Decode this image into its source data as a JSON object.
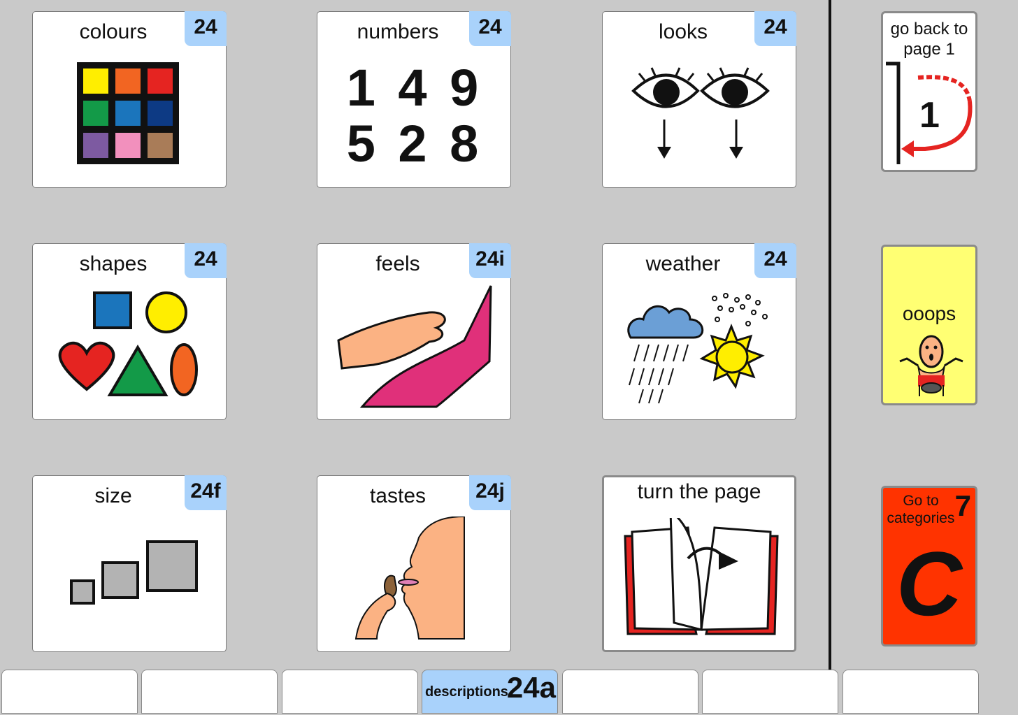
{
  "cells": [
    {
      "label": "colours",
      "badge": "24"
    },
    {
      "label": "numbers",
      "badge": "24"
    },
    {
      "label": "looks",
      "badge": "24"
    },
    {
      "label": "shapes",
      "badge": "24"
    },
    {
      "label": "feels",
      "badge": "24i"
    },
    {
      "label": "weather",
      "badge": "24"
    },
    {
      "label": "size",
      "badge": "24f"
    },
    {
      "label": "tastes",
      "badge": "24j"
    },
    {
      "label": "turn the page"
    }
  ],
  "numbers_digits": {
    "row1": "1 4 9",
    "row2": "5 2 8"
  },
  "sidebar": {
    "back": {
      "label": "go back to page 1",
      "number": "1"
    },
    "oops": {
      "label": "ooops"
    },
    "categories": {
      "label": "Go to categories",
      "number": "7",
      "letter": "C"
    }
  },
  "tabs": [
    {
      "label": ""
    },
    {
      "label": ""
    },
    {
      "label": ""
    },
    {
      "label": "descriptions",
      "number": "24a"
    },
    {
      "label": ""
    },
    {
      "label": ""
    },
    {
      "label": ""
    }
  ],
  "colors": {
    "background": "#c9c9c9",
    "badge": "#a9d2fb",
    "oops_bg": "#ffff73",
    "categories_bg": "#ff3300"
  }
}
